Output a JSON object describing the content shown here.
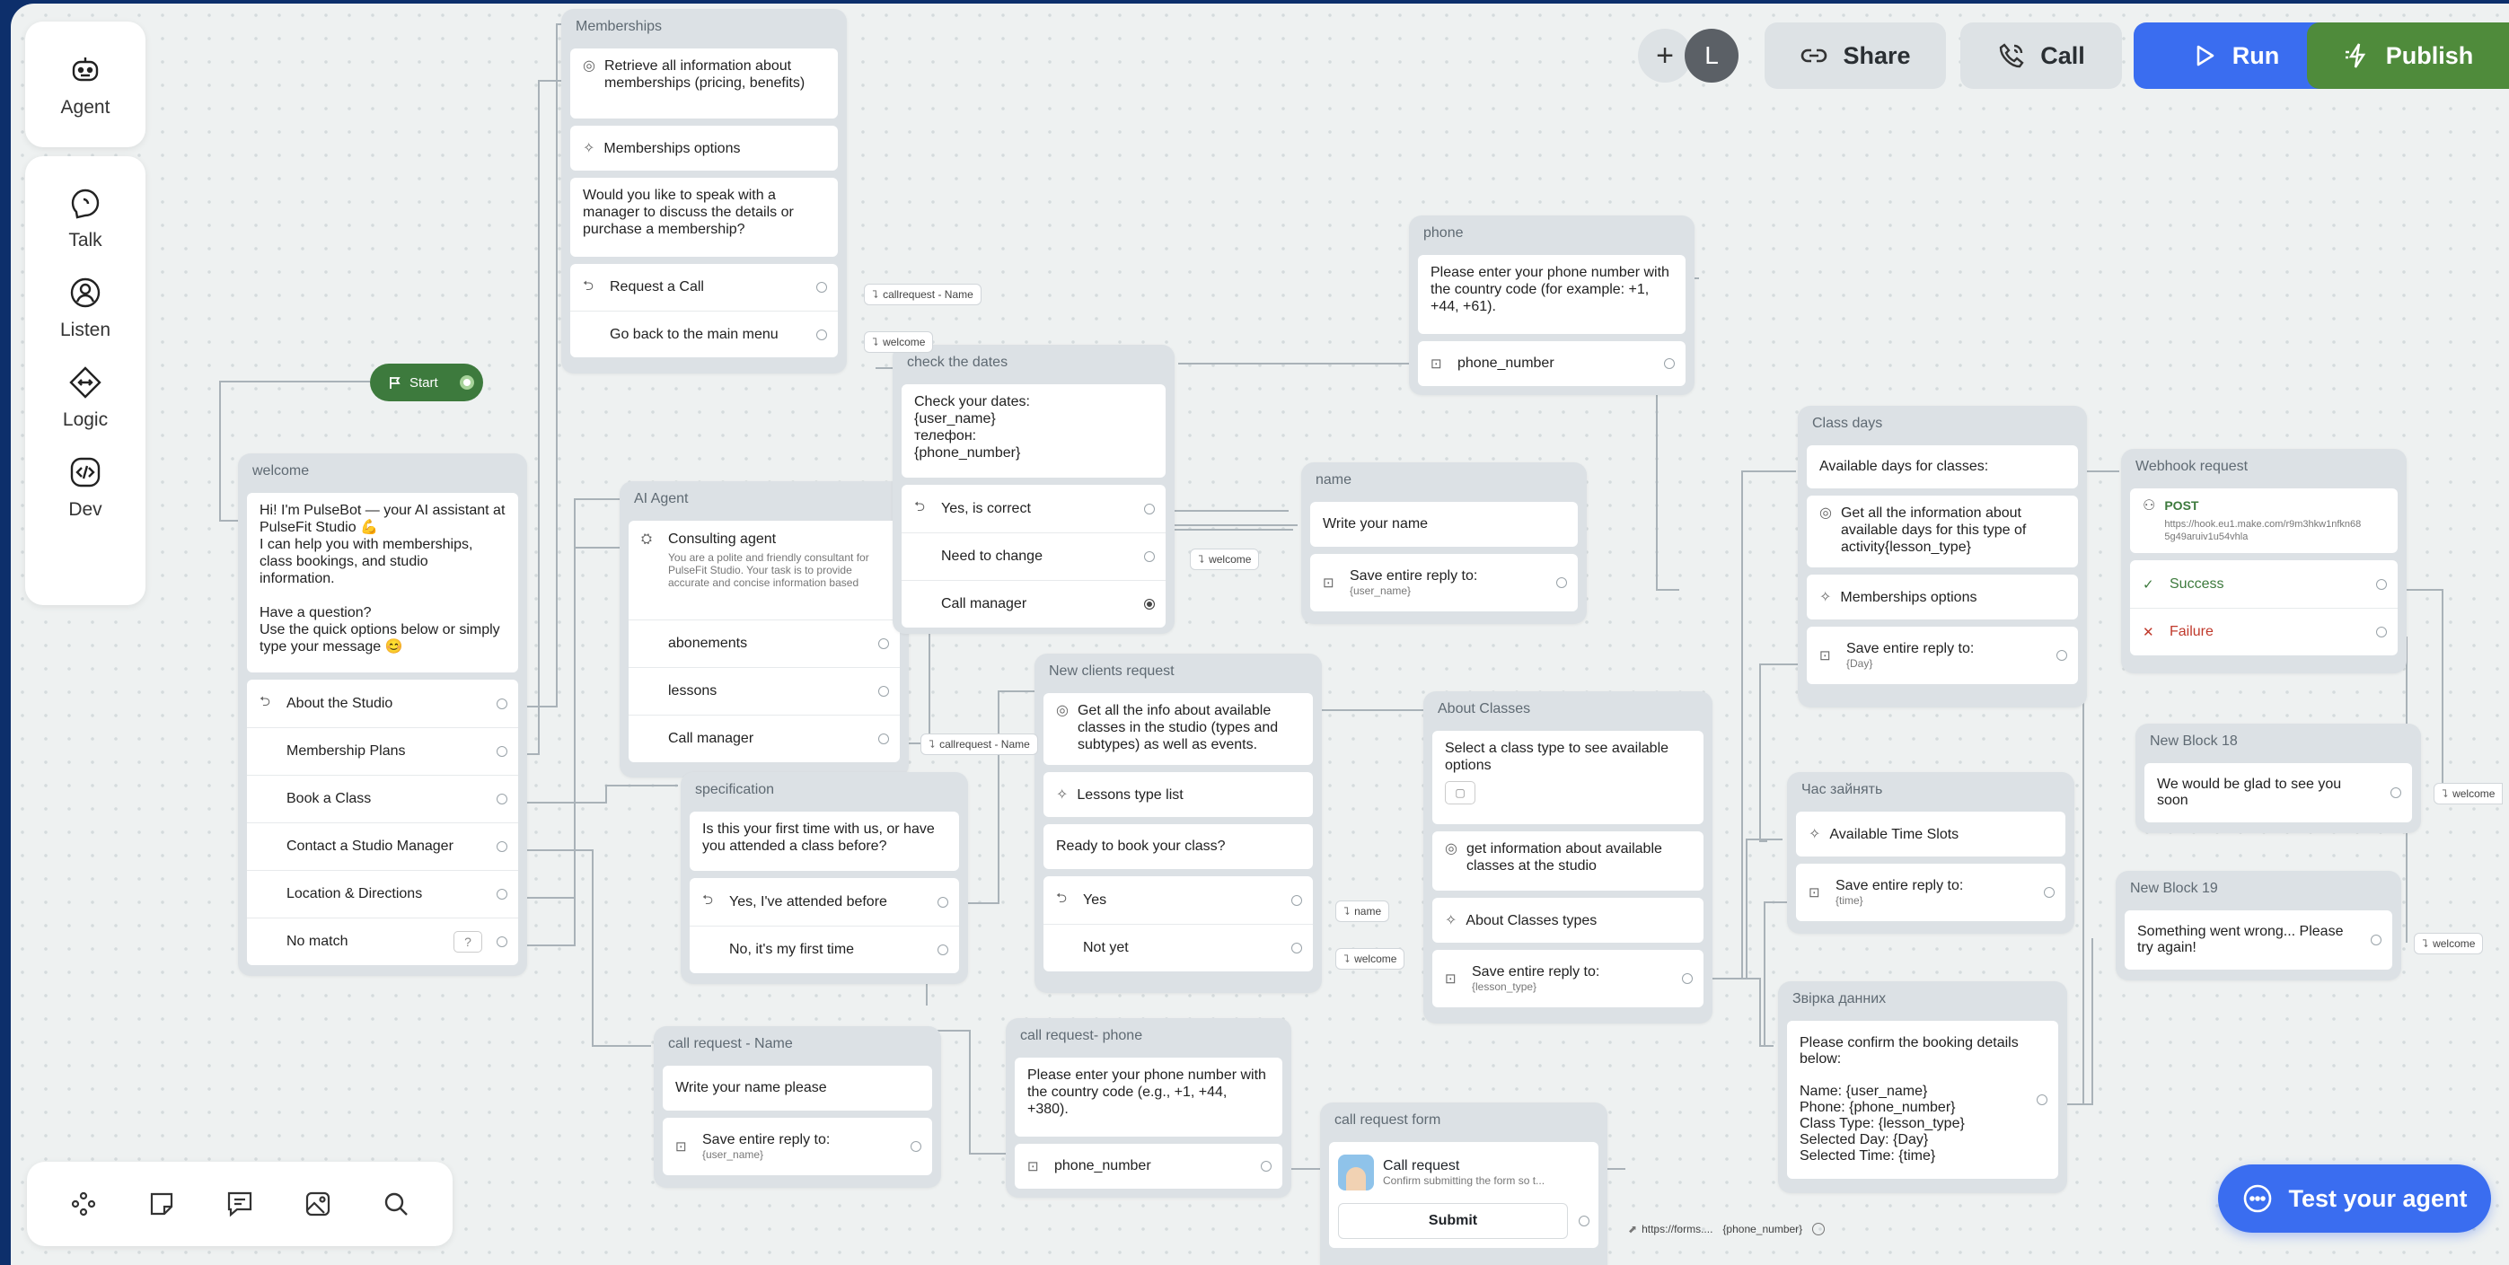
{
  "sidebar": {
    "items": [
      {
        "name": "sidebar-agent",
        "icon": "robot-icon",
        "label": "Agent"
      },
      {
        "name": "sidebar-talk",
        "icon": "speech-icon",
        "label": "Talk"
      },
      {
        "name": "sidebar-listen",
        "icon": "ear-icon",
        "label": "Listen"
      },
      {
        "name": "sidebar-logic",
        "icon": "logic-icon",
        "label": "Logic"
      },
      {
        "name": "sidebar-dev",
        "icon": "code-icon",
        "label": "Dev"
      }
    ]
  },
  "topbar": {
    "add": "+",
    "avatar": "L",
    "share": "Share",
    "call": "Call",
    "run": "Run",
    "publish": "Publish"
  },
  "colors": {
    "run": "#3a6df0",
    "publish": "#4f8b3b",
    "start": "#3d7a3d",
    "test": "#3a6df0",
    "background": "#eef1f1"
  },
  "start": {
    "label": "Start"
  },
  "test_agent": "Test your agent",
  "memberships": {
    "title": "Memberships",
    "retrieve": "Retrieve all information about memberships (pricing, benefits)",
    "options": "Memberships options",
    "question": "Would you like to speak with a manager to discuss the details or purchase a membership?",
    "request_call": "Request a Call",
    "go_back": "Go back to the main menu"
  },
  "welcome": {
    "title": "welcome",
    "message": "Hi! I'm PulseBot — your AI assistant at PulseFit Studio 💪\nI can help you with memberships, class bookings, and studio information.\n\nHave a question?\nUse the quick options below or simply type your message 😊",
    "options": [
      "About the Studio",
      "Membership Plans",
      "Book a Class",
      "Contact a Studio Manager",
      "Location & Directions",
      "No match"
    ]
  },
  "ai_agent": {
    "title": "AI Agent",
    "name": "Consulting agent",
    "desc": "You are a polite and friendly consultant for PulseFit Studio. Your task is to provide accurate and concise information based strictly on the...",
    "items": [
      "abonements",
      "lessons",
      "Call manager"
    ]
  },
  "check_dates": {
    "title": "check the dates",
    "message": "Check your dates:\n{user_name}\nтелефон:\n{phone_number}",
    "items": [
      "Yes, is correct",
      "Need to change",
      "Call manager"
    ]
  },
  "phone": {
    "title": "phone",
    "message": "Please enter your phone number with the country code (for example: +1, +44, +61).",
    "var": "phone_number"
  },
  "name_node": {
    "title": "name",
    "message": "Write your name",
    "save": "Save entire reply to:",
    "var": "{user_name}"
  },
  "class_days": {
    "title": "Class days",
    "header": "Available days for classes:",
    "info": "Get all the information about available days for this type of activity{lesson_type}",
    "options": "Memberships options",
    "save": "Save entire reply to:",
    "var": "{Day}"
  },
  "webhook": {
    "title": "Webhook request",
    "method": "POST",
    "url": "https://hook.eu1.make.com/r9m3hkw1nfkn685g49aruiv1u54vhla",
    "success": "Success",
    "failure": "Failure"
  },
  "new_clients": {
    "title": "New clients request",
    "info": "Get all the info about available classes in the studio (types and subtypes) as well as events.",
    "lessons": "Lessons type list",
    "question": "Ready to book your class?",
    "yes": "Yes",
    "no": "Not yet"
  },
  "specification": {
    "title": "specification",
    "question": "Is this your first time with us, or have you attended a class before?",
    "yes": "Yes, I've attended before",
    "no": "No, it's my first time"
  },
  "about_classes": {
    "title": "About Classes",
    "message": "Select a class type to see available options",
    "info": "get information about available classes at the studio",
    "types": "About Classes types",
    "save": "Save entire reply to:",
    "var": "{lesson_type}"
  },
  "time_node": {
    "title": "Час зайнять",
    "slots": "Available Time Slots",
    "save": "Save entire reply to:",
    "var": "{time}"
  },
  "new18": {
    "title": "New Block 18",
    "message": "We would be glad to see you soon"
  },
  "new19": {
    "title": "New Block 19",
    "message": "Something went wrong... Please try again!"
  },
  "confirm": {
    "title": "Звірка данних",
    "message": "Please confirm the booking details below:\n\nName: {user_name}\nPhone: {phone_number}\nClass Type: {lesson_type}\nSelected Day: {Day}\nSelected Time: {time}"
  },
  "call_name": {
    "title": "call request - Name",
    "message": "Write your name please",
    "save": "Save entire reply to:",
    "var": "{user_name}"
  },
  "call_phone": {
    "title": "call request- phone",
    "message": "Please enter your phone number with the country code (e.g., +1, +44, +380).",
    "var": "phone_number"
  },
  "call_form": {
    "title": "call request form",
    "name": "Call request",
    "desc": "Confirm submitting the form so t...",
    "submit": "Submit"
  },
  "pills": {
    "callrequest_name": "callrequest - Name",
    "welcome": "welcome",
    "name": "name",
    "form_url": "https://forms....",
    "form_var": "{phone_number}"
  }
}
